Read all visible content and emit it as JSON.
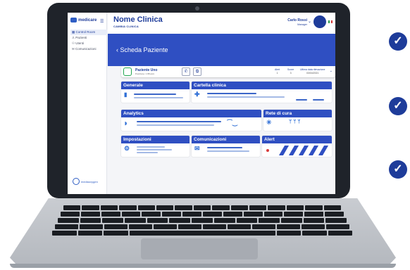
{
  "sidebar": {
    "brand": "medicare",
    "items": [
      {
        "label": "Control Room",
        "active": true
      },
      {
        "label": "Pazienti",
        "active": false
      },
      {
        "label": "Utenti",
        "active": false
      },
      {
        "label": "Comunicazioni",
        "active": false
      }
    ],
    "footer_brand": "mediaoxygen"
  },
  "header": {
    "clinic_name": "Nome Clinica",
    "clinic_subtitle": "CAMBIA CLINICA",
    "user_name": "Carlo Rossi",
    "user_role": "Manager"
  },
  "banner": {
    "title": "Scheda Paziente"
  },
  "patient": {
    "name": "Paziente Uno",
    "meta": "Posizione: 1   88 anni",
    "alert_label": "Alert",
    "alert_value": "1",
    "score_label": "Score",
    "score_value": "3",
    "last_label": "Ultima data rilevazione",
    "last_value": "03/04/2021"
  },
  "cards": {
    "generale": "Generale",
    "cartella": "Cartella clinica",
    "analytics": "Analytics",
    "rete": "Rete di cura",
    "impostazioni": "Impostazioni",
    "comunicazioni": "Comunicazioni",
    "alert": "Alert"
  },
  "colors": {
    "primary": "#2f4fc2",
    "accent_green": "#22a651",
    "alert_red": "#d83a3a"
  }
}
